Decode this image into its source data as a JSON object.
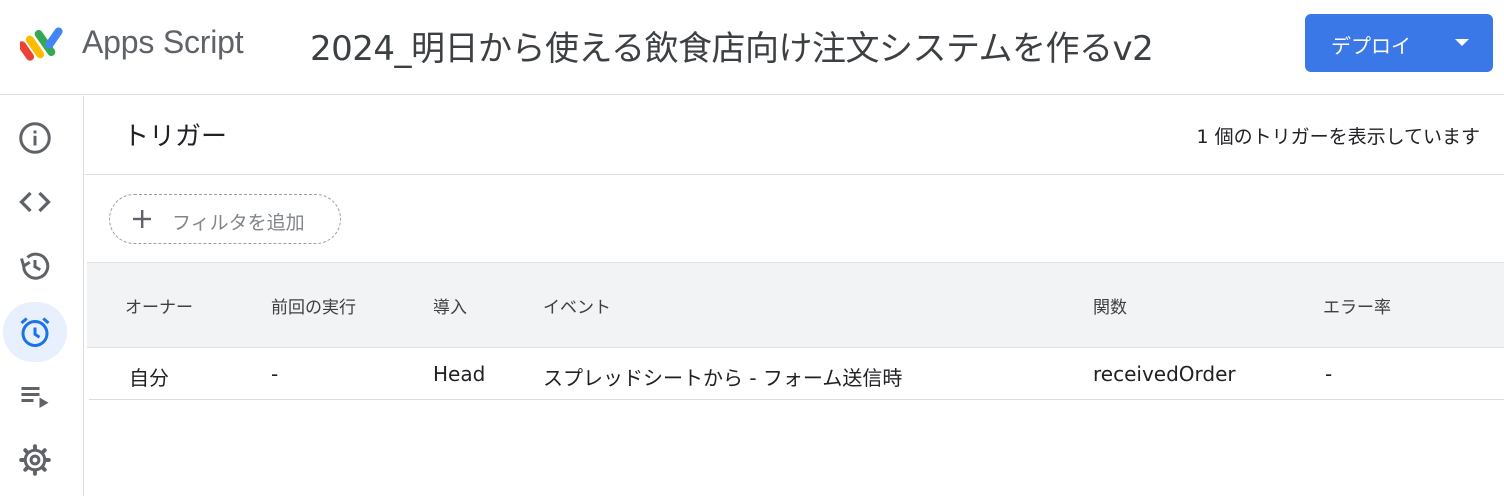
{
  "header": {
    "app_name": "Apps Script",
    "project_title": "2024_明日から使える飲食店向け注文システムを作るv2",
    "deploy_label": "デプロイ"
  },
  "sidebar": {
    "items": [
      {
        "icon": "info-icon",
        "active": false
      },
      {
        "icon": "code-icon",
        "active": false
      },
      {
        "icon": "history-icon",
        "active": false
      },
      {
        "icon": "alarm-clock-icon",
        "active": true
      },
      {
        "icon": "executions-icon",
        "active": false
      },
      {
        "icon": "gear-icon",
        "active": false
      }
    ]
  },
  "main": {
    "title": "トリガー",
    "count_text": "1 個のトリガーを表示しています",
    "filter_label": "フィルタを追加",
    "table": {
      "columns": [
        "オーナー",
        "前回の実行",
        "導入",
        "イベント",
        "関数",
        "エラー率"
      ],
      "rows": [
        [
          "自分",
          "-",
          "Head",
          "スプレッドシートから - フォーム送信時",
          "receivedOrder",
          "-"
        ]
      ]
    }
  },
  "colors": {
    "accent": "#3b78e7",
    "active_nav_bg": "#e8f0fe",
    "header_row_bg": "#f1f3f4"
  }
}
